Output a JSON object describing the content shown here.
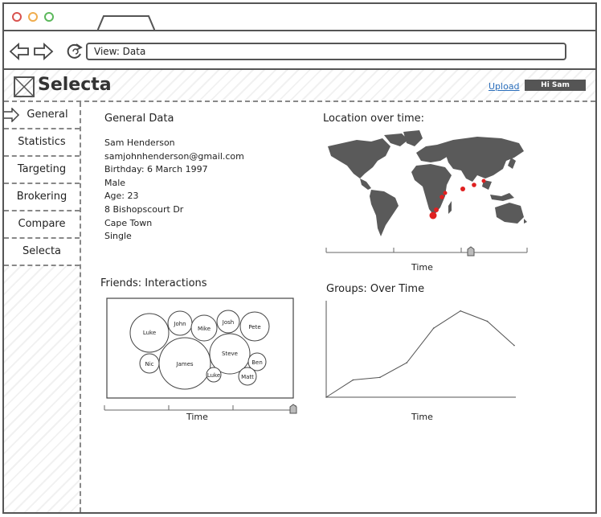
{
  "browser": {
    "address": "View: Data",
    "traffic_colors": [
      "#d9534f",
      "#f0ad4e",
      "#5cb85c"
    ]
  },
  "header": {
    "logo": "Selecta",
    "upload_label": "Upload",
    "user_label": "Hi Sam"
  },
  "sidebar": {
    "items": [
      {
        "label": "General"
      },
      {
        "label": "Statistics"
      },
      {
        "label": "Targeting"
      },
      {
        "label": "Brokering"
      },
      {
        "label": "Compare"
      },
      {
        "label": "Selecta"
      }
    ],
    "active": "General"
  },
  "general": {
    "title": "General Data",
    "lines": [
      "Sam Henderson",
      "samjohnhenderson@gmail.com",
      "Birthday: 6 March 1997",
      "Male",
      "Age: 23",
      "8 Bishopscourt Dr",
      "Cape Town",
      "Single"
    ]
  },
  "location": {
    "title": "Location over time:",
    "slider_label": "Time",
    "marker_color": "#e02020"
  },
  "friends": {
    "title": "Friends: Interactions",
    "slider_label": "Time",
    "bubbles": [
      "Luke",
      "John",
      "Mike",
      "Josh",
      "Pete",
      "Nic",
      "James",
      "Steve",
      "Ben",
      "Luke",
      "Matt"
    ]
  },
  "groups": {
    "title": "Groups: Over Time",
    "xlabel": "Time"
  },
  "chart_data": {
    "type": "line",
    "title": "Groups: Over Time",
    "xlabel": "Time",
    "ylabel": "",
    "x": [
      0,
      1,
      2,
      3,
      4,
      5,
      6,
      7
    ],
    "series": [
      {
        "values": [
          0,
          20,
          23,
          40,
          80,
          100,
          88,
          60
        ]
      }
    ],
    "ylim": [
      0,
      110
    ],
    "grid": false
  }
}
